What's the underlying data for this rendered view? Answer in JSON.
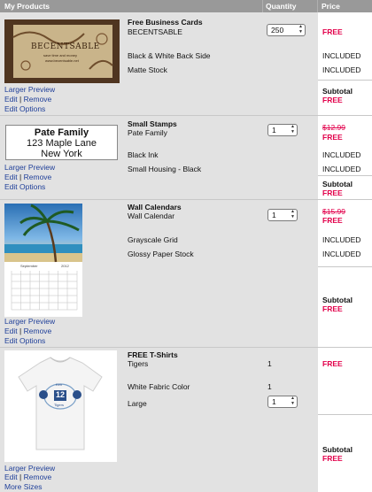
{
  "header": {
    "products": "My Products",
    "quantity": "Quantity",
    "price": "Price"
  },
  "items": [
    {
      "title": "Free Business Cards",
      "subtitle": "BECENTSABLE",
      "options": [
        "Black & White Back Side",
        "Matte Stock"
      ],
      "quantity": "250",
      "price": "FREE",
      "option_prices": [
        "INCLUDED",
        "INCLUDED"
      ],
      "subtotal_label": "Subtotal",
      "subtotal": "FREE",
      "links": {
        "preview": "Larger Preview",
        "edit": "Edit",
        "remove": "Remove",
        "options": "Edit Options"
      },
      "thumb_text": {
        "brand": "BECENTSABLE",
        "tagline": "save time and money",
        "url": "www.becentsable.net"
      }
    },
    {
      "title": "Small Stamps",
      "subtitle": "Pate Family",
      "options": [
        "Black Ink",
        "Small Housing - Black"
      ],
      "quantity": "1",
      "old_price": "$12.99",
      "price": "FREE",
      "option_prices": [
        "INCLUDED",
        "INCLUDED"
      ],
      "subtotal_label": "Subtotal",
      "subtotal": "FREE",
      "links": {
        "preview": "Larger Preview",
        "edit": "Edit",
        "remove": "Remove",
        "options": "Edit Options"
      },
      "thumb_text": {
        "line1": "Pate Family",
        "line2": "123 Maple Lane",
        "line3": "New York"
      }
    },
    {
      "title": "Wall Calendars",
      "subtitle": "Wall Calendar",
      "options": [
        "Grayscale Grid",
        "Glossy Paper Stock"
      ],
      "quantity": "1",
      "old_price": "$15.99",
      "price": "FREE",
      "option_prices": [
        "INCLUDED",
        "INCLUDED"
      ],
      "subtotal_label": "Subtotal",
      "subtotal": "FREE",
      "links": {
        "preview": "Larger Preview",
        "edit": "Edit",
        "remove": "Remove",
        "options": "Edit Options"
      },
      "thumb_text": {
        "month": "September",
        "year": "2012"
      }
    },
    {
      "title": "FREE T-Shirts",
      "subtitle": "Tigers",
      "options": [
        "White Fabric Color",
        "Large"
      ],
      "quantity": "1",
      "option_qty": [
        "1"
      ],
      "size_qty": "1",
      "price": "FREE",
      "subtotal_label": "Subtotal",
      "subtotal": "FREE",
      "links": {
        "preview": "Larger Preview",
        "edit": "Edit",
        "remove": "Remove",
        "options": "More Sizes"
      },
      "thumb_text": {
        "top": "Ken",
        "number": "12",
        "bottom": "Tigers"
      }
    }
  ]
}
